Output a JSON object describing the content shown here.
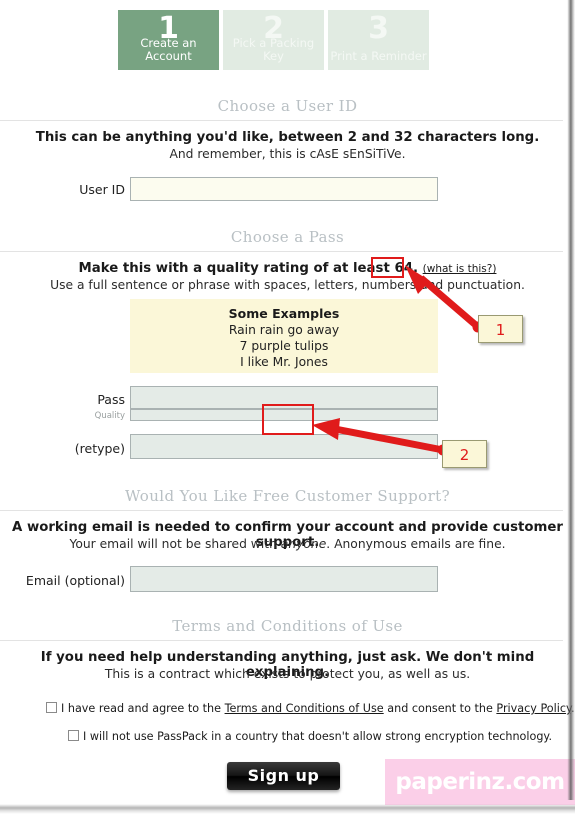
{
  "steps": [
    {
      "number": "1",
      "caption": "Create an Account",
      "state": "active"
    },
    {
      "number": "2",
      "caption": "Pick a Packing Key",
      "state": "inactive"
    },
    {
      "number": "3",
      "caption": "Print a Reminder",
      "state": "inactive"
    }
  ],
  "sections": {
    "userid": {
      "header": "Choose a User ID",
      "bold": "This can be anything you'd like, between 2 and 32 characters long.",
      "sub": "And remember, this is cAsE sEnSiTiVe.",
      "label": "User ID",
      "value": "",
      "placeholder": ""
    },
    "pass": {
      "header": "Choose a Pass",
      "bold_prefix": "Make this with a quality rating of at least",
      "rating": "64.",
      "what_is_this": "(what is this?)",
      "sub": "Use a full sentence or phrase with spaces, letters, numbers and punctuation.",
      "examples_title": "Some Examples",
      "examples": [
        "Rain rain go away",
        "7 purple tulips",
        "I like Mr. Jones"
      ],
      "pass_label": "Pass",
      "pass_value": "",
      "quality_label": "Quality",
      "retype_label": "(retype)",
      "retype_value": ""
    },
    "email": {
      "header": "Would You Like Free Customer Support?",
      "bold": "A working email is needed to confirm your account and provide customer support.",
      "sub_a": "Your email will not be shared with ",
      "sub_em": "anyone",
      "sub_b": ". Anonymous emails are fine.",
      "label": "Email (optional)",
      "value": "",
      "placeholder": ""
    },
    "terms": {
      "header": "Terms and Conditions of Use",
      "bold": "If you need help understanding anything, just ask. We don't mind explaining.",
      "sub": "This is a contract which exists to protect you, as well as us.",
      "check1_a": "I have read and agree to the ",
      "check1_link1": "Terms and Conditions of Use",
      "check1_b": " and consent to the ",
      "check1_link2": "Privacy Policy",
      "check1_c": ".",
      "check1_checked": false,
      "check2": "I will not use PassPack in a country that doesn't allow strong encryption technology.",
      "check2_checked": false
    }
  },
  "submit_label": "Sign up",
  "watermark": "paperinz.com",
  "annotations": [
    {
      "id": "1",
      "label": "1"
    },
    {
      "id": "2",
      "label": "2"
    }
  ],
  "colors": {
    "step_active": "#78a382",
    "step_inactive": "#e1ebe2",
    "annotation_red": "#e01b1b",
    "examples_bg": "#fbf7d8",
    "field_cream": "#fcfcef",
    "field_grey": "#e4ebe7",
    "watermark_bg": "#fbcfe8"
  }
}
